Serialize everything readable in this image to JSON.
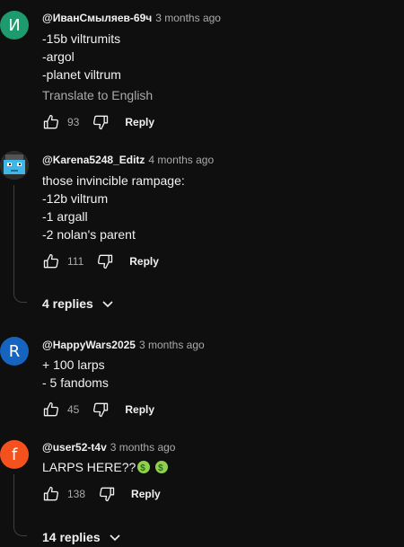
{
  "comments": [
    {
      "avatar_letter": "И",
      "avatar_color": "#1e9b6e",
      "handle": "@ИванСмыляев-69ч",
      "time": "3 months ago",
      "lines": [
        "-15b viltrumits",
        "-argol",
        "-planet viltrum"
      ],
      "translate_label": "Translate to English",
      "likes": "93",
      "reply_label": "Reply"
    },
    {
      "avatar_icon": "minecraft-character-avatar",
      "avatar_color": "#3a3a3a",
      "handle": "@Karena5248_Editz",
      "time": "4 months ago",
      "lines": [
        "those invincible rampage:",
        "-12b viltrum",
        "-1 argall",
        "-2 nolan's parent"
      ],
      "likes": "111",
      "reply_label": "Reply",
      "replies_label": "4 replies"
    },
    {
      "avatar_letter": "R",
      "avatar_color": "#1565c0",
      "handle": "@HappyWars2025",
      "time": "3 months ago",
      "lines": [
        "+ 100 larps",
        "- 5 fandoms"
      ],
      "likes": "45",
      "reply_label": "Reply"
    },
    {
      "avatar_letter": "f",
      "avatar_color": "#f4511e",
      "handle": "@user52-t4v",
      "time": "3 months ago",
      "lines": [
        "LARPS HERE??"
      ],
      "emoji_icon": "money-mouth-face-icon",
      "likes": "138",
      "reply_label": "Reply",
      "replies_label": "14 replies"
    }
  ]
}
